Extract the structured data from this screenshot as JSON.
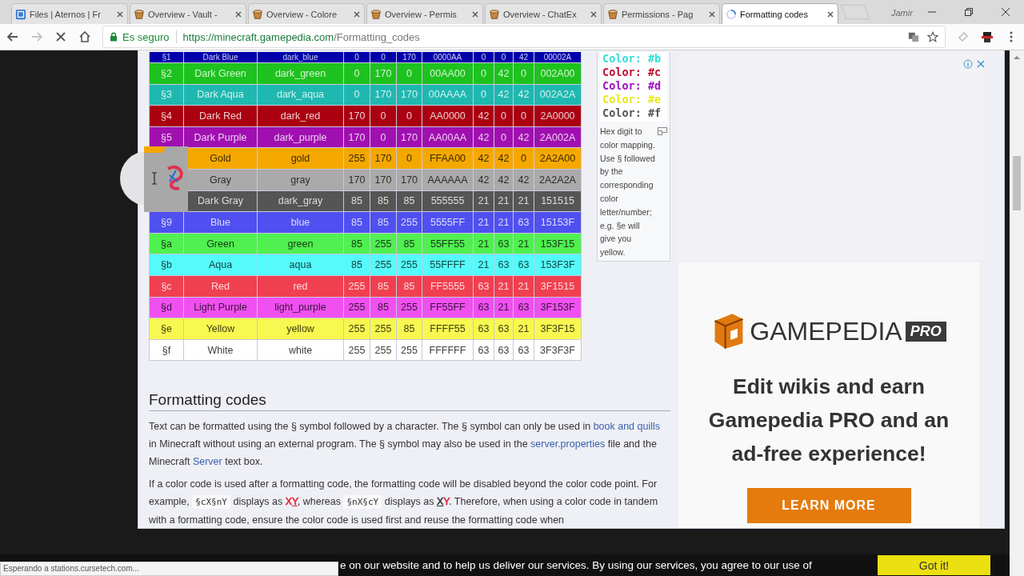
{
  "browser": {
    "tabs": [
      {
        "title": "Files | Aternos | Fr",
        "kind": "aternos",
        "selected": false
      },
      {
        "title": "Overview - Vault -",
        "kind": "bucket",
        "selected": false
      },
      {
        "title": "Overview - Colore",
        "kind": "bucket",
        "selected": false
      },
      {
        "title": "Overview - Permis",
        "kind": "bucket",
        "selected": false
      },
      {
        "title": "Overview - ChatEx",
        "kind": "bucket",
        "selected": false
      },
      {
        "title": "Permissions - Pag",
        "kind": "bucket",
        "selected": false
      },
      {
        "title": "Formatting codes",
        "kind": "loading",
        "selected": true
      }
    ],
    "profile": "Jamir",
    "security_label": "Es seguro",
    "url_host": "https://minecraft.gamepedia.com",
    "url_path": "/Formatting_codes"
  },
  "color_table": {
    "rows": [
      {
        "code": "§1",
        "cells": [
          "Dark Blue",
          "dark_blue",
          "0",
          "0",
          "170",
          "0000AA",
          "0",
          "0",
          "42",
          "00002A"
        ],
        "color": "#0000aa"
      },
      {
        "code": "§2",
        "cells": [
          "Dark Green",
          "dark_green",
          "0",
          "170",
          "0",
          "00AA00",
          "0",
          "42",
          "0",
          "002A00"
        ],
        "color": "#1ec21e"
      },
      {
        "code": "§3",
        "cells": [
          "Dark Aqua",
          "dark_aqua",
          "0",
          "170",
          "170",
          "00AAAA",
          "0",
          "42",
          "42",
          "002A2A"
        ],
        "color": "#1fb8b0"
      },
      {
        "code": "§4",
        "cells": [
          "Dark Red",
          "dark_red",
          "170",
          "0",
          "0",
          "AA0000",
          "42",
          "0",
          "0",
          "2A0000"
        ],
        "color": "#aa0010"
      },
      {
        "code": "§5",
        "cells": [
          "Dark Purple",
          "dark_purple",
          "170",
          "0",
          "170",
          "AA00AA",
          "42",
          "0",
          "42",
          "2A002A"
        ],
        "color": "#a010b0"
      },
      {
        "cells": [
          "Gold",
          "gold",
          "255",
          "170",
          "0",
          "FFAA00",
          "42",
          "42",
          "0",
          "2A2A00"
        ],
        "color": "#f5a800"
      },
      {
        "cells": [
          "Gray",
          "gray",
          "170",
          "170",
          "170",
          "AAAAAA",
          "42",
          "42",
          "42",
          "2A2A2A"
        ],
        "color": "#aaaaaa"
      },
      {
        "cells": [
          "Dark Gray",
          "dark_gray",
          "85",
          "85",
          "85",
          "555555",
          "21",
          "21",
          "21",
          "151515"
        ],
        "color": "#555555"
      },
      {
        "code": "§9",
        "cells": [
          "Blue",
          "blue",
          "85",
          "85",
          "255",
          "5555FF",
          "21",
          "21",
          "63",
          "15153F"
        ],
        "color": "#5050f0"
      },
      {
        "code": "§a",
        "cells": [
          "Green",
          "green",
          "85",
          "255",
          "85",
          "55FF55",
          "21",
          "63",
          "21",
          "153F15"
        ],
        "color": "#50f050"
      },
      {
        "code": "§b",
        "cells": [
          "Aqua",
          "aqua",
          "85",
          "255",
          "255",
          "55FFFF",
          "21",
          "63",
          "63",
          "153F3F"
        ],
        "color": "#55fafa"
      },
      {
        "code": "§c",
        "cells": [
          "Red",
          "red",
          "255",
          "85",
          "85",
          "FF5555",
          "63",
          "21",
          "21",
          "3F1515"
        ],
        "color": "#f04050"
      },
      {
        "code": "§d",
        "cells": [
          "Light Purple",
          "light_purple",
          "255",
          "85",
          "255",
          "FF55FF",
          "63",
          "21",
          "63",
          "3F153F"
        ],
        "color": "#f050f0"
      },
      {
        "code": "§e",
        "cells": [
          "Yellow",
          "yellow",
          "255",
          "255",
          "85",
          "FFFF55",
          "63",
          "63",
          "21",
          "3F3F15"
        ],
        "color": "#f8f850"
      },
      {
        "code": "§f",
        "cells": [
          "White",
          "white",
          "255",
          "255",
          "255",
          "FFFFFF",
          "63",
          "63",
          "63",
          "3F3F3F"
        ],
        "color": "#ffffff"
      }
    ]
  },
  "figure": {
    "lines": [
      {
        "text": "Color: #b",
        "color": "#33e0d8"
      },
      {
        "text": "Color: #c",
        "color": "#c01030"
      },
      {
        "text": "Color: #d",
        "color": "#a010c0"
      },
      {
        "text": "Color: #e",
        "color": "#e8e820"
      },
      {
        "text": "Color: #f",
        "color": "#555555"
      }
    ],
    "caption": "Hex digit to color mapping. Use § followed by the corresponding color letter/number; e.g. §e will give you yellow."
  },
  "section": {
    "heading": "Formatting codes",
    "paragraphs": [
      {
        "segments": [
          {
            "kind": "text",
            "text": "Text can be formatted using the § symbol followed by a character. The § symbol can only be used in "
          },
          {
            "kind": "link",
            "text": "book and quills"
          },
          {
            "kind": "text",
            "text": " in Minecraft without using an external program. The § symbol may also be used in the "
          },
          {
            "kind": "link",
            "text": "server.properties"
          },
          {
            "kind": "text",
            "text": " file and the Minecraft "
          },
          {
            "kind": "link",
            "text": "Server"
          },
          {
            "kind": "text",
            "text": " text box."
          }
        ]
      },
      {
        "segments": [
          {
            "kind": "text",
            "text": "If a color code is used after a formatting code, the formatting code will be disabled beyond the color code point. For example, "
          },
          {
            "kind": "code",
            "text": "§cX§nY"
          },
          {
            "kind": "text",
            "text": " displays as "
          },
          {
            "kind": "sample",
            "chars": [
              {
                "text": "X",
                "color": "#dd2233",
                "underline": false
              },
              {
                "text": "Y",
                "color": "#dd2233",
                "underline": true
              }
            ]
          },
          {
            "kind": "text",
            "text": ", whereas "
          },
          {
            "kind": "code",
            "text": "§nX§cY"
          },
          {
            "kind": "text",
            "text": " displays as "
          },
          {
            "kind": "sample",
            "chars": [
              {
                "text": "X",
                "color": "#333333",
                "underline": true
              },
              {
                "text": "Y",
                "color": "#dd2233",
                "underline": false
              }
            ]
          },
          {
            "kind": "text",
            "text": ". Therefore, when using a color code in tandem with a formatting code, ensure the color code is used first and reuse the formatting code when"
          }
        ]
      }
    ]
  },
  "ad": {
    "brand": "GAMEPEDIA",
    "badge": "PRO",
    "headline": "Edit wikis and earn Gamepedia PRO and an ad-free experience!",
    "button": "LEARN MORE"
  },
  "cookie_banner": {
    "text": "e on our website and to help us deliver our services. By using our services, you agree to our use of",
    "button": "Got it!"
  },
  "status": "Esperando a stations.cursetech.com..."
}
